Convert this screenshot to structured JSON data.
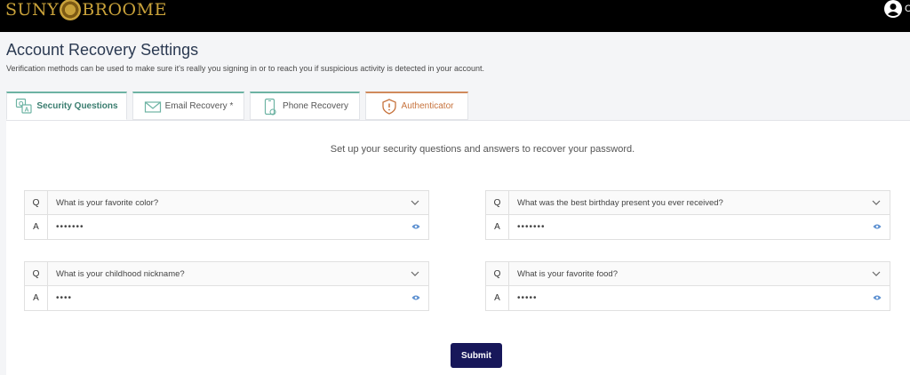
{
  "header": {
    "logo_left": "SUNY",
    "logo_right": "BROOME",
    "user_initial": "C"
  },
  "page": {
    "title": "Account Recovery Settings",
    "description": "Verification methods can be used to make sure it's really you signing in or to reach you if suspicious activity is detected in your account."
  },
  "tabs": [
    {
      "label": "Security Questions",
      "icon": "qa-icon"
    },
    {
      "label": "Email Recovery *",
      "icon": "envelope-icon"
    },
    {
      "label": "Phone Recovery",
      "icon": "phone-icon"
    },
    {
      "label": "Authenticator",
      "icon": "shield-icon"
    }
  ],
  "instruction": "Set up your security questions and answers to recover your password.",
  "qa_labels": {
    "q": "Q",
    "a": "A"
  },
  "questions": [
    {
      "question": "What is your favorite color?",
      "answer_masked": "•••••••"
    },
    {
      "question": "What was the best birthday present you ever received?",
      "answer_masked": "•••••••"
    },
    {
      "question": "What is your childhood nickname?",
      "answer_masked": "••••"
    },
    {
      "question": "What is your favorite food?",
      "answer_masked": "•••••"
    }
  ],
  "submit_label": "Submit",
  "colors": {
    "topbar": "#000000",
    "logo_gold": "#c9a23a",
    "title": "#2b3a52",
    "tab_security": "#6db3a3",
    "tab_auth": "#d08a5c",
    "submit": "#17175a",
    "eye": "#5b8fd0"
  }
}
